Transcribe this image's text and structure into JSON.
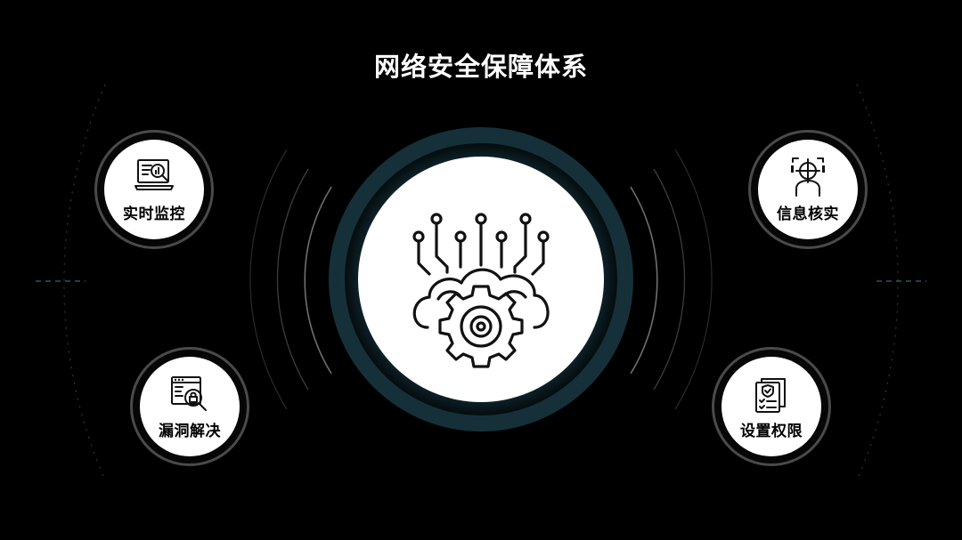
{
  "title": "网络安全保障体系",
  "center": {
    "icon": "cloud-brain-gear-icon"
  },
  "nodes": [
    {
      "label": "实时监控",
      "icon": "monitor-magnifier-icon"
    },
    {
      "label": "信息核实",
      "icon": "person-crosshair-icon"
    },
    {
      "label": "漏洞解决",
      "icon": "browser-lock-magnifier-icon"
    },
    {
      "label": "设置权限",
      "icon": "shield-checklist-icon"
    }
  ],
  "colors": {
    "background": "#000000",
    "circle_fill": "#ffffff",
    "ring_gray": "#4a4a4a",
    "accent_teal": "#1f3a42"
  }
}
